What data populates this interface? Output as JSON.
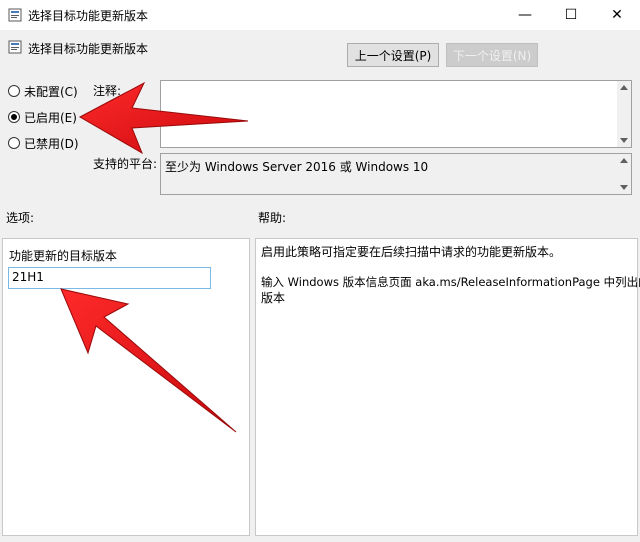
{
  "window": {
    "title": "选择目标功能更新版本",
    "controls": {
      "minimize": "—",
      "maximize": "☐",
      "close": "✕"
    }
  },
  "header": {
    "title": "选择目标功能更新版本",
    "prev_button": "上一个设置(P)",
    "next_button": "下一个设置(N)"
  },
  "state": {
    "options": [
      {
        "label": "未配置(C)",
        "selected": false
      },
      {
        "label": "已启用(E)",
        "selected": true
      },
      {
        "label": "已禁用(D)",
        "selected": false
      }
    ]
  },
  "comment": {
    "label": "注释:",
    "value": ""
  },
  "supported": {
    "label": "支持的平台:",
    "value": "至少为 Windows Server 2016 或 Windows 10"
  },
  "options_section": {
    "label": "选项:",
    "field_label": "功能更新的目标版本",
    "field_value": "21H1"
  },
  "help_section": {
    "label": "帮助:",
    "paragraph1": "启用此策略可指定要在后续扫描中请求的功能更新版本。",
    "paragraph2_line1": "输入 Windows 版本信息页面 aka.ms/ReleaseInformationPage 中列出的",
    "paragraph2_line2": "版本"
  },
  "colors": {
    "annotation_arrow": "#e8161b",
    "input_focus_border": "#7ab8e6",
    "window_bg": "#f0f0f0"
  },
  "icons": [
    "policy-icon",
    "red-arrow-annotation"
  ]
}
